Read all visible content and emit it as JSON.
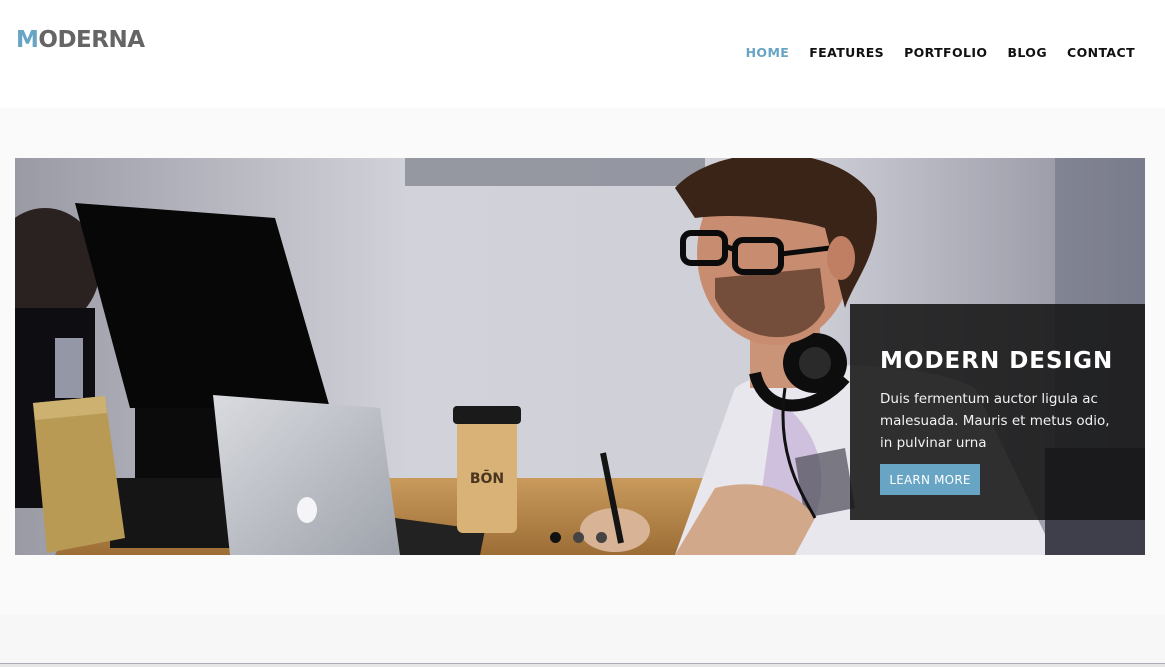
{
  "brand": {
    "logo_first": "M",
    "logo_rest": "ODERNA"
  },
  "nav": {
    "items": [
      {
        "label": "HOME",
        "active": true
      },
      {
        "label": "FEATURES",
        "active": false
      },
      {
        "label": "PORTFOLIO",
        "active": false
      },
      {
        "label": "BLOG",
        "active": false
      },
      {
        "label": "CONTACT",
        "active": false
      }
    ]
  },
  "slider": {
    "caption_title": "MODERN DESIGN",
    "caption_text": "Duis fermentum auctor ligula ac malesuada. Mauris et metus odio, in pulvinar urna",
    "button_label": "LEARN MORE",
    "dots": 3,
    "active_dot": 0,
    "cup_text": "BŌN"
  },
  "colors": {
    "accent": "#68a4c4",
    "nav_text": "#111111",
    "caption_bg": "#161616"
  }
}
